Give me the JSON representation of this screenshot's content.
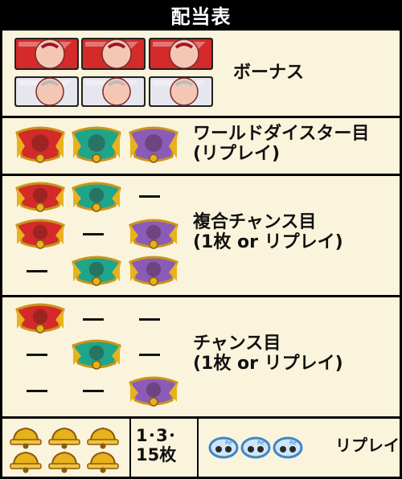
{
  "header": {
    "title": "配当表"
  },
  "rows": {
    "bonus": {
      "label": "ボーナス"
    },
    "world": {
      "label": "ワールドダイスター目\n(リプレイ)"
    },
    "fukugo": {
      "label": "複合チャンス目\n(1枚 or リプレイ)"
    },
    "chance": {
      "label": "チャンス目\n(1枚 or リプレイ)"
    },
    "replay": {
      "payout": "1･3･\n15枚",
      "label": "リプレイ"
    }
  },
  "icons": {
    "seven_red": "red-seven-character-icon",
    "seven_white": "white-seven-character-icon",
    "wings_red": "red-wing-emblem-icon",
    "wings_green": "green-wing-emblem-icon",
    "wings_purple": "purple-wing-emblem-icon",
    "bell": "bell-icon",
    "replay": "replay-icon"
  },
  "colors": {
    "panel_bg": "#fbf4dc",
    "background": "#000000",
    "red": "#d42a2a",
    "green": "#1fa58a",
    "purple": "#8b5bb8",
    "gold": "#e7b21b"
  }
}
